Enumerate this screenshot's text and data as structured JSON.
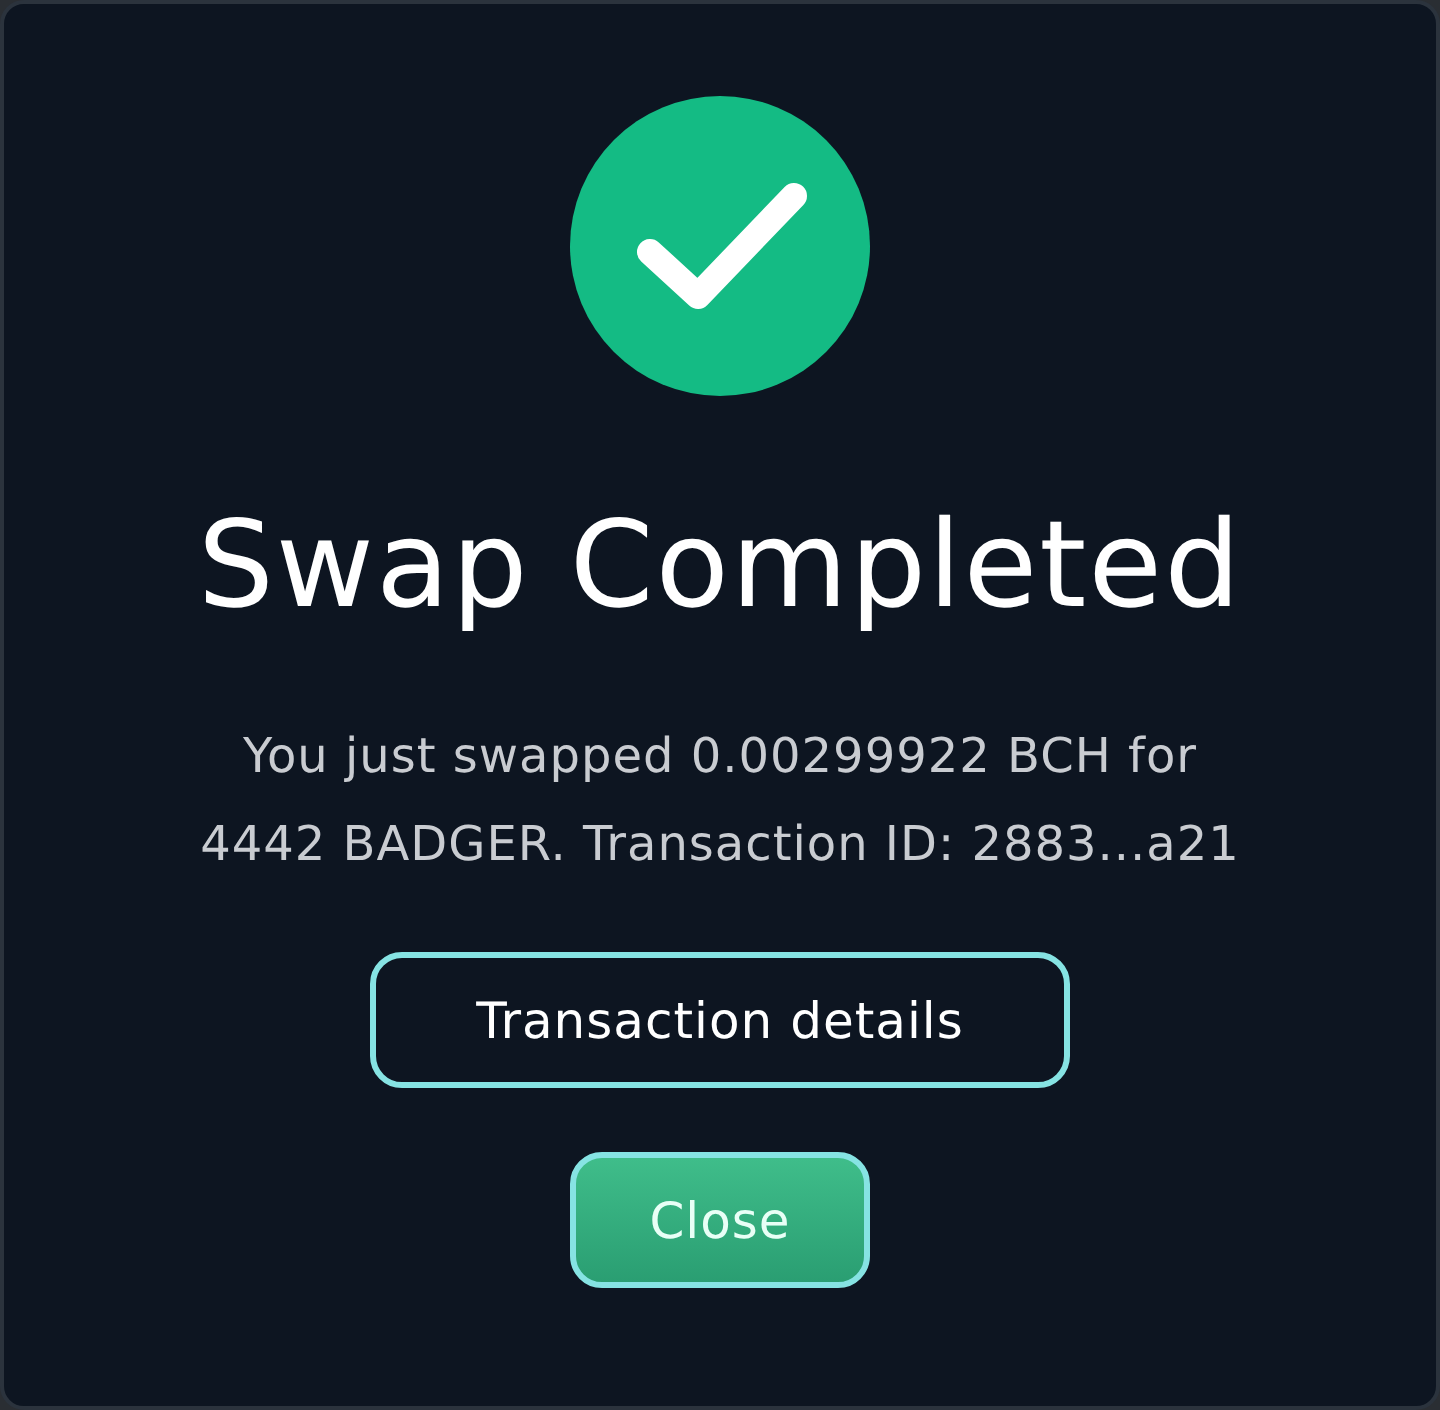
{
  "dialog": {
    "succeeded": true,
    "title": "Swap Completed",
    "message_lines": [
      "You just swapped 0.00299922 BCH for",
      "4442 BADGER. Transaction ID: 2883...a21"
    ],
    "buttons": [
      {
        "label": "Transaction details",
        "kind": "outline"
      },
      {
        "label": "Close",
        "kind": "primary"
      }
    ]
  }
}
